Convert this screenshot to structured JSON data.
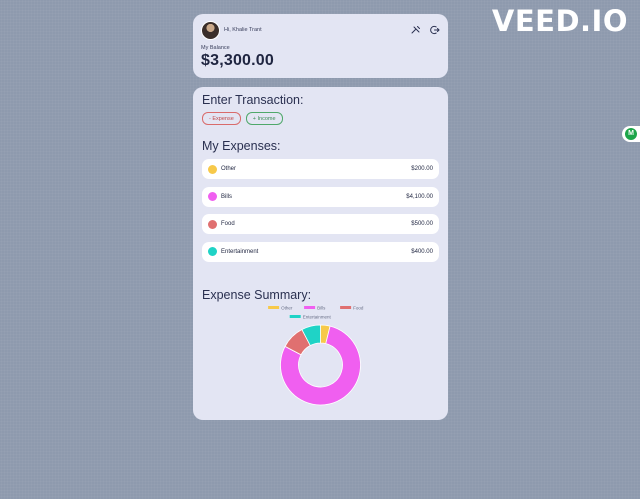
{
  "watermark": "VEED.IO",
  "header": {
    "greeting": "Hi, Khalie Trant",
    "balance_label": "My Balance",
    "balance_value": "$3,300.00",
    "icons": [
      "settings-icon",
      "logout-icon"
    ]
  },
  "transaction": {
    "title": "Enter Transaction:",
    "expense_label": "- Expense",
    "income_label": "+ Income"
  },
  "expenses": {
    "title": "My Expenses:",
    "items": [
      {
        "name": "Other",
        "amount": "$200.00",
        "color": "#f7c94a"
      },
      {
        "name": "Bills",
        "amount": "$4,100.00",
        "color": "#f05ff0"
      },
      {
        "name": "Food",
        "amount": "$500.00",
        "color": "#e07070"
      },
      {
        "name": "Entertainment",
        "amount": "$400.00",
        "color": "#1fd3c6"
      }
    ]
  },
  "summary": {
    "title": "Expense Summary:"
  },
  "chart_data": {
    "type": "pie",
    "categories": [
      "Other",
      "Bills",
      "Food",
      "Entertainment"
    ],
    "values": [
      200,
      4100,
      500,
      400
    ],
    "colors": [
      "#f7c94a",
      "#f05ff0",
      "#e07070",
      "#1fd3c6"
    ],
    "legend": "top",
    "donut": true
  }
}
